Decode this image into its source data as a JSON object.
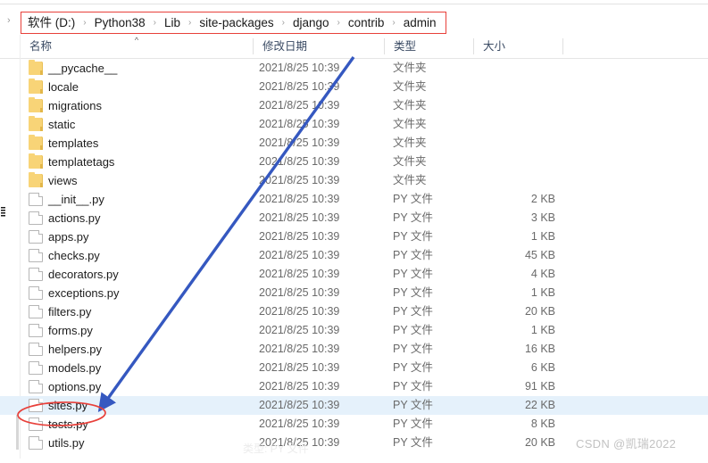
{
  "window": {
    "breadcrumb": {
      "lead_chevron": "›",
      "separator": "›",
      "items": [
        "软件 (D:)",
        "Python38",
        "Lib",
        "site-packages",
        "django",
        "contrib",
        "admin"
      ],
      "highlight_color": "#e8403a"
    }
  },
  "columns": {
    "name": "名称",
    "date_modified": "修改日期",
    "type": "类型",
    "size": "大小",
    "sort_indicator": "^"
  },
  "files": [
    {
      "name": "__pycache__",
      "icon": "folder-icon",
      "date": "2021/8/25 10:39",
      "type": "文件夹",
      "size": "",
      "selected": false
    },
    {
      "name": "locale",
      "icon": "folder-icon",
      "date": "2021/8/25 10:39",
      "type": "文件夹",
      "size": "",
      "selected": false
    },
    {
      "name": "migrations",
      "icon": "folder-icon",
      "date": "2021/8/25 10:39",
      "type": "文件夹",
      "size": "",
      "selected": false
    },
    {
      "name": "static",
      "icon": "folder-icon",
      "date": "2021/8/25 10:39",
      "type": "文件夹",
      "size": "",
      "selected": false
    },
    {
      "name": "templates",
      "icon": "folder-icon",
      "date": "2021/8/25 10:39",
      "type": "文件夹",
      "size": "",
      "selected": false
    },
    {
      "name": "templatetags",
      "icon": "folder-icon",
      "date": "2021/8/25 10:39",
      "type": "文件夹",
      "size": "",
      "selected": false
    },
    {
      "name": "views",
      "icon": "folder-icon",
      "date": "2021/8/25 10:39",
      "type": "文件夹",
      "size": "",
      "selected": false
    },
    {
      "name": "__init__.py",
      "icon": "py-file-icon",
      "date": "2021/8/25 10:39",
      "type": "PY 文件",
      "size": "2 KB",
      "selected": false
    },
    {
      "name": "actions.py",
      "icon": "py-file-icon",
      "date": "2021/8/25 10:39",
      "type": "PY 文件",
      "size": "3 KB",
      "selected": false
    },
    {
      "name": "apps.py",
      "icon": "py-file-icon",
      "date": "2021/8/25 10:39",
      "type": "PY 文件",
      "size": "1 KB",
      "selected": false
    },
    {
      "name": "checks.py",
      "icon": "py-file-icon",
      "date": "2021/8/25 10:39",
      "type": "PY 文件",
      "size": "45 KB",
      "selected": false
    },
    {
      "name": "decorators.py",
      "icon": "py-file-icon",
      "date": "2021/8/25 10:39",
      "type": "PY 文件",
      "size": "4 KB",
      "selected": false
    },
    {
      "name": "exceptions.py",
      "icon": "py-file-icon",
      "date": "2021/8/25 10:39",
      "type": "PY 文件",
      "size": "1 KB",
      "selected": false
    },
    {
      "name": "filters.py",
      "icon": "py-file-icon",
      "date": "2021/8/25 10:39",
      "type": "PY 文件",
      "size": "20 KB",
      "selected": false
    },
    {
      "name": "forms.py",
      "icon": "py-file-icon",
      "date": "2021/8/25 10:39",
      "type": "PY 文件",
      "size": "1 KB",
      "selected": false
    },
    {
      "name": "helpers.py",
      "icon": "py-file-icon",
      "date": "2021/8/25 10:39",
      "type": "PY 文件",
      "size": "16 KB",
      "selected": false
    },
    {
      "name": "models.py",
      "icon": "py-file-icon",
      "date": "2021/8/25 10:39",
      "type": "PY 文件",
      "size": "6 KB",
      "selected": false
    },
    {
      "name": "options.py",
      "icon": "py-file-icon",
      "date": "2021/8/25 10:39",
      "type": "PY 文件",
      "size": "91 KB",
      "selected": false
    },
    {
      "name": "sites.py",
      "icon": "py-file-icon",
      "date": "2021/8/25 10:39",
      "type": "PY 文件",
      "size": "22 KB",
      "selected": true
    },
    {
      "name": "tests.py",
      "icon": "py-file-icon",
      "date": "2021/8/25 10:39",
      "type": "PY 文件",
      "size": "8 KB",
      "selected": false
    },
    {
      "name": "utils.py",
      "icon": "py-file-icon",
      "date": "2021/8/25 10:39",
      "type": "PY 文件",
      "size": "20 KB",
      "selected": false
    }
  ],
  "annotations": {
    "ellipse_color": "#e8403a",
    "arrow_color": "#3558c0",
    "target_row": "sites.py"
  },
  "watermark": "CSDN @凯瑞2022",
  "ghost_text": "类型: PY 文件"
}
